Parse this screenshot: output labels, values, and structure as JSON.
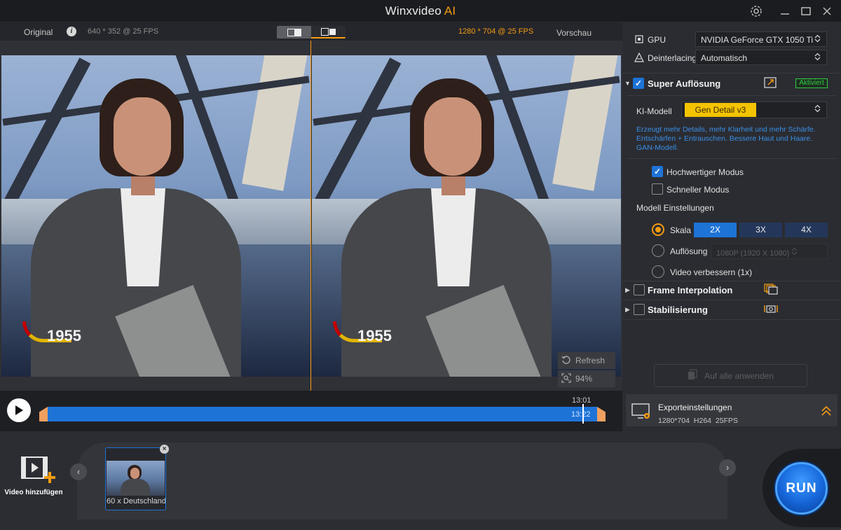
{
  "app": {
    "title": "Winxvideo",
    "title_ai": "AI"
  },
  "preview": {
    "original_label": "Original",
    "original_info": "640 * 352 @ 25 FPS",
    "output_info": "1280 * 704 @ 25 FPS",
    "preview_label": "Vorschau",
    "overlay_year": "1955",
    "refresh_label": "Refresh",
    "zoom_label": "94%"
  },
  "timeline": {
    "current_time": "13:01",
    "end_time": "13:22"
  },
  "settings": {
    "gpu_label": "GPU",
    "gpu_value": "NVIDIA GeForce GTX 1050 Ti",
    "deinterlacing_label": "Deinterlacing",
    "deinterlacing_value": "Automatisch",
    "super_resolution": {
      "title": "Super Auflösung",
      "checked": true,
      "badge": "Aktiviert",
      "model_label": "KI-Modell",
      "model_value": "Gen Detail v3",
      "description": "Erzeugt mehr Details, mehr Klarheit und mehr Schärfe. Entschärfen + Entrauschen. Bessere Haut und Haare. GAN-Modell.",
      "high_quality_label": "Hochwertiger Modus",
      "high_quality_checked": true,
      "fast_label": "Schneller Modus",
      "fast_checked": false,
      "model_settings_label": "Modell Einstellungen",
      "scale_label": "Skala",
      "scale_options": [
        "2X",
        "3X",
        "4X"
      ],
      "scale_selected": "2X",
      "resolution_label": "Auflösung",
      "resolution_value": "1080P (1920 X 1080)",
      "enhance_label": "Video verbessern (1x)"
    },
    "frame_interpolation": {
      "title": "Frame Interpolation",
      "checked": false
    },
    "stabilization": {
      "title": "Stabilisierung",
      "checked": false
    },
    "apply_all_label": "Auf alle anwenden",
    "export": {
      "title": "Exporteinstellungen",
      "resolution": "1280*704",
      "codec": "H264",
      "fps": "25FPS"
    }
  },
  "media": {
    "add_video_label": "Video hinzufügen",
    "items": [
      {
        "name": "60 x Deutschland"
      }
    ]
  },
  "run_label": "RUN",
  "colors": {
    "accent_orange": "#f39c12",
    "accent_blue": "#1e73d7",
    "active_green": "#2ecc40",
    "model_yellow": "#f5c400"
  }
}
